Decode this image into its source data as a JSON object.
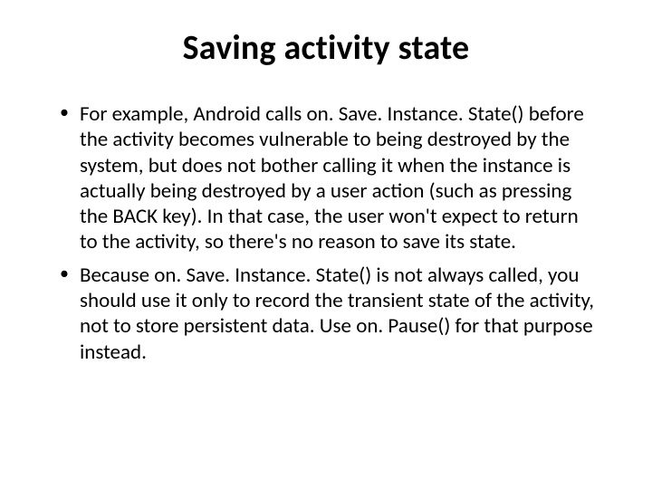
{
  "slide": {
    "title": "Saving activity state",
    "bullets": [
      "For example, Android calls on. Save. Instance. State() before the activity becomes vulnerable to being destroyed by the system, but does not bother calling it when the instance is actually being destroyed by a user action (such as pressing the BACK key). In that case, the user won't expect to return to the activity, so there's no reason to save its state.",
      "Because on. Save. Instance. State() is not always called, you should use it only to record the transient state of the activity, not to store persistent data. Use on. Pause() for that purpose instead."
    ]
  }
}
